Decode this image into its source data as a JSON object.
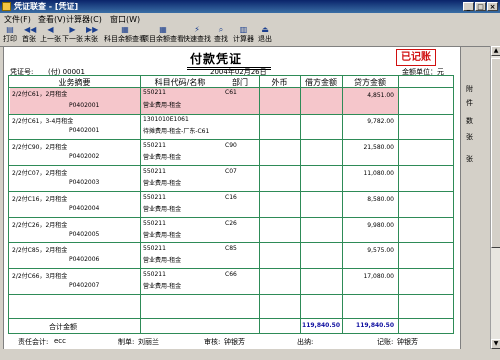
{
  "window": {
    "title": "凭证联查 - [凭证]",
    "minimize": "_",
    "maximize": "□",
    "close": "×"
  },
  "menu": [
    "文件(F)",
    "查看(V)",
    "计算器(C)",
    "窗口(W)"
  ],
  "toolbar": {
    "print": "打印",
    "first": "首张",
    "prev": "上一张",
    "next": "下一张",
    "last": "末张",
    "subledger_lookup": "科目余额查看",
    "project_lookup": "项目余额查看",
    "quick_find": "快速查找",
    "find": "查找",
    "calculator": "计算器",
    "exit": "退出"
  },
  "voucher": {
    "title": "付款凭证",
    "status_stamp": "已记账",
    "number_label": "凭证号:",
    "number": "(付) 00001",
    "date": "2004年02月26日",
    "unit": "金额单位：元",
    "headers": {
      "summary": "业务摘要",
      "account": "科目代码/名称",
      "dept": "部门",
      "currency": "外币",
      "debit": "借方金额",
      "credit": "贷方金额"
    },
    "rows": [
      {
        "summary": "2/2付C61，2月租金",
        "ref": "P0402001",
        "code": "550211",
        "name": "营业费用-租金",
        "dept": "C61",
        "debit": "4,851.00",
        "credit": ""
      },
      {
        "summary": "2/2付C61，3-4月租金",
        "ref": "P0402001",
        "code": "1301010E1061",
        "name": "待摊费用-租金-厂东-C61",
        "dept": "",
        "debit": "9,782.00",
        "credit": ""
      },
      {
        "summary": "2/2付C90，2月租金",
        "ref": "P0402002",
        "code": "550211",
        "name": "营业费用-租金",
        "dept": "C90",
        "debit": "21,580.00",
        "credit": ""
      },
      {
        "summary": "2/2付C07，2月租金",
        "ref": "P0402003",
        "code": "550211",
        "name": "营业费用-租金",
        "dept": "C07",
        "debit": "11,080.00",
        "credit": ""
      },
      {
        "summary": "2/2付C16，2月租金",
        "ref": "P0402004",
        "code": "550211",
        "name": "营业费用-租金",
        "dept": "C16",
        "debit": "8,580.00",
        "credit": ""
      },
      {
        "summary": "2/2付C26，2月租金",
        "ref": "P0402005",
        "code": "550211",
        "name": "营业费用-租金",
        "dept": "C26",
        "debit": "9,980.00",
        "credit": ""
      },
      {
        "summary": "2/2付C85，2月租金",
        "ref": "P0402006",
        "code": "550211",
        "name": "营业费用-租金",
        "dept": "C85",
        "debit": "9,575.00",
        "credit": ""
      },
      {
        "summary": "2/2付C66，3月租金",
        "ref": "P0402007",
        "code": "550211",
        "name": "营业费用-租金",
        "dept": "C66",
        "debit": "17,080.00",
        "credit": ""
      }
    ],
    "total_label": "合计金额",
    "total_debit": "119,840.50",
    "total_credit": "119,840.50"
  },
  "attachments": {
    "line1": "附",
    "line2": "件",
    "line3": "张",
    "line4": "数",
    "line5": "张"
  },
  "signatures": {
    "supervisor_label": "责任会计:",
    "supervisor": "ecc",
    "maker_label": "制单:",
    "maker": "刘丽兰",
    "auditor_label": "审核:",
    "auditor": "钟银芳",
    "cashier_label": "出纳:",
    "cashier": "",
    "poster_label": "记账:",
    "poster": "钟银芳"
  }
}
